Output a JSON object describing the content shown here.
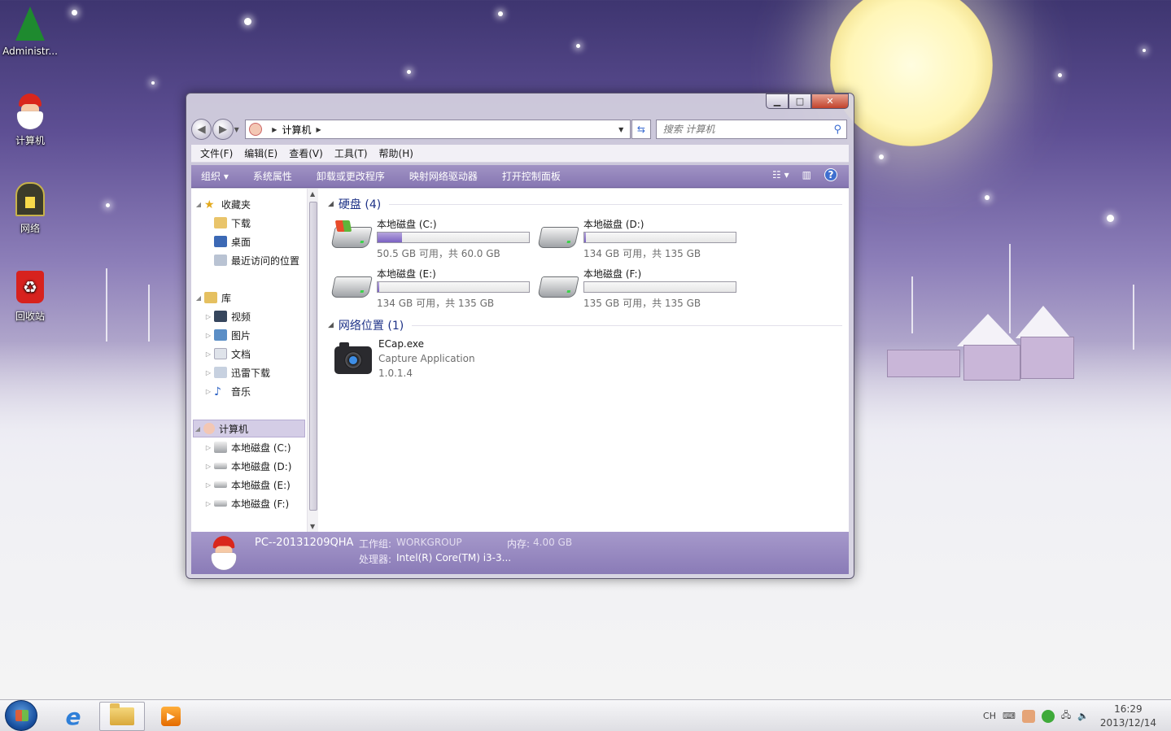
{
  "desktop": {
    "icons": [
      {
        "label": "Administr..."
      },
      {
        "label": "计算机"
      },
      {
        "label": "网络"
      },
      {
        "label": "回收站"
      }
    ]
  },
  "window": {
    "address": {
      "crumb": "计算机"
    },
    "search": {
      "placeholder": "搜索 计算机"
    },
    "menu": [
      "文件(F)",
      "编辑(E)",
      "查看(V)",
      "工具(T)",
      "帮助(H)"
    ],
    "commands": [
      "组织 ▾",
      "系统属性",
      "卸载或更改程序",
      "映射网络驱动器",
      "打开控制面板"
    ],
    "navpane": {
      "favorites": {
        "label": "收藏夹",
        "items": [
          "下载",
          "桌面",
          "最近访问的位置"
        ]
      },
      "libraries": {
        "label": "库",
        "items": [
          "视频",
          "图片",
          "文档",
          "迅雷下载",
          "音乐"
        ]
      },
      "computer": {
        "label": "计算机",
        "items": [
          "本地磁盘 (C:)",
          "本地磁盘 (D:)",
          "本地磁盘 (E:)",
          "本地磁盘 (F:)"
        ]
      }
    },
    "content": {
      "hard_disks": {
        "header": "硬盘 (4)",
        "drives": [
          {
            "name": "本地磁盘 (C:)",
            "free": "50.5 GB 可用，共 60.0 GB",
            "used_fraction": 0.16
          },
          {
            "name": "本地磁盘 (D:)",
            "free": "134 GB 可用，共 135 GB",
            "used_fraction": 0.01
          },
          {
            "name": "本地磁盘 (E:)",
            "free": "134 GB 可用，共 135 GB",
            "used_fraction": 0.01
          },
          {
            "name": "本地磁盘 (F:)",
            "free": "135 GB 可用，共 135 GB",
            "used_fraction": 0.0
          }
        ]
      },
      "network": {
        "header": "网络位置 (1)",
        "item": {
          "name": "ECap.exe",
          "description": "Capture Application",
          "version": "1.0.1.4"
        }
      }
    },
    "details": {
      "computer_name": "PC--20131209QHA",
      "workgroup_label": "工作组:",
      "workgroup_value": "WORKGROUP",
      "memory_label": "内存:",
      "memory_value": "4.00 GB",
      "cpu_label": "处理器:",
      "cpu_value": "Intel(R) Core(TM) i3-3..."
    }
  },
  "taskbar": {
    "lang": "CH",
    "time": "16:29",
    "date": "2013/12/14"
  }
}
